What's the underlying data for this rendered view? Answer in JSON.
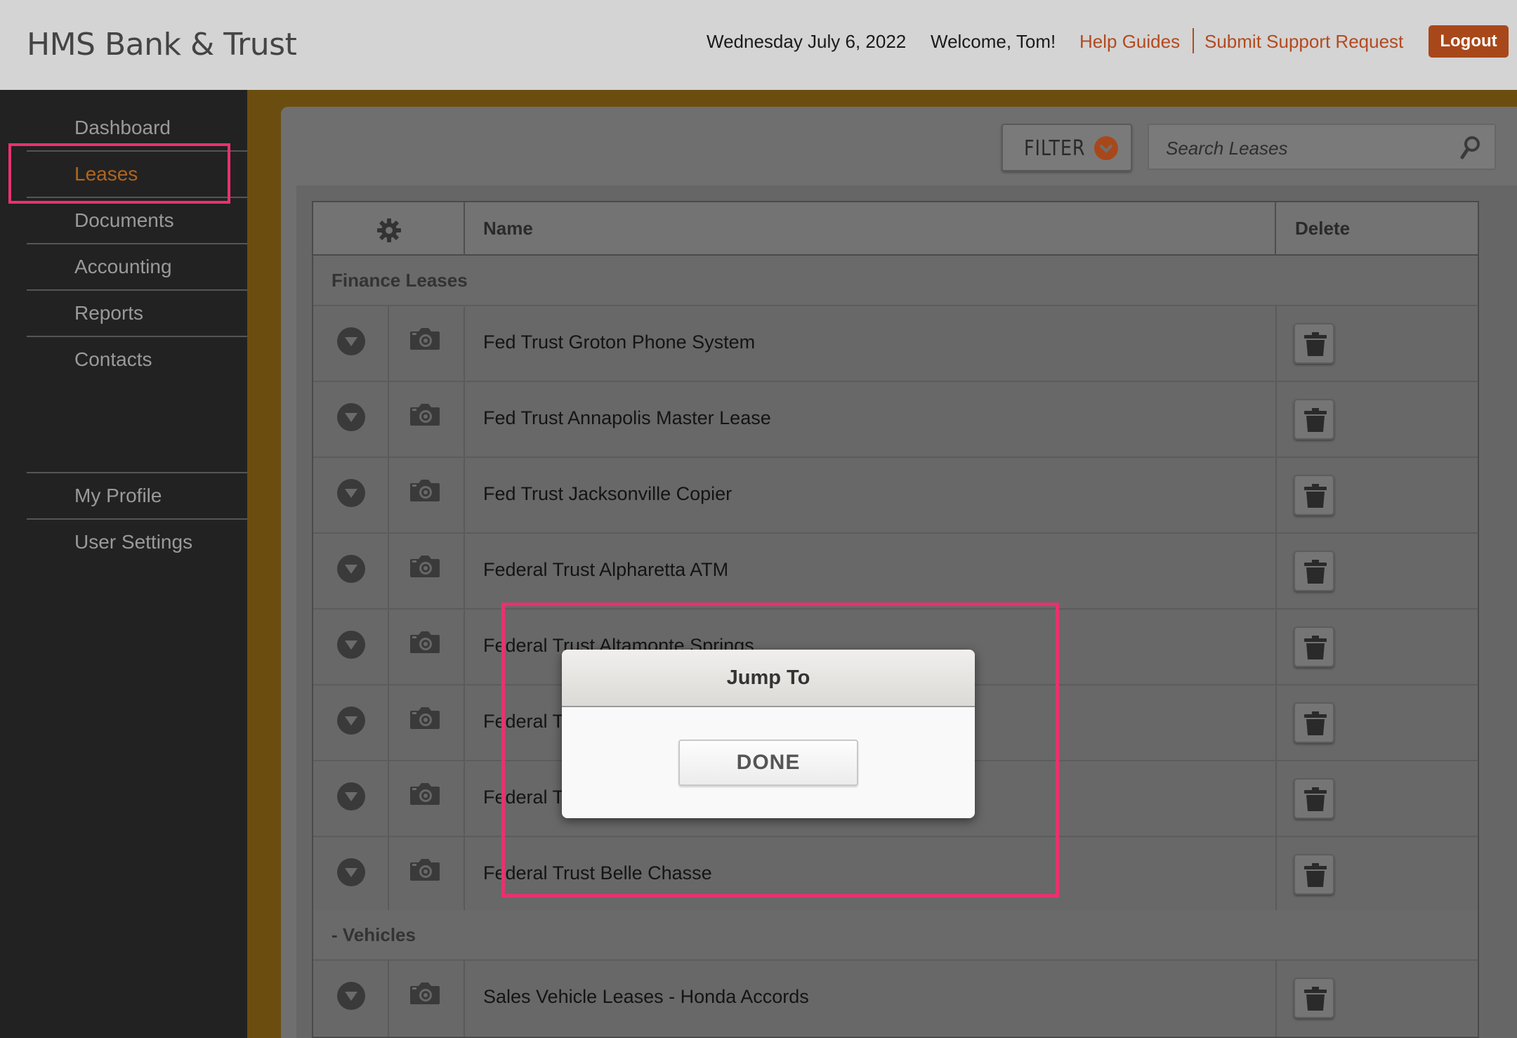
{
  "header": {
    "brand": "HMS Bank & Trust",
    "date": "Wednesday July 6, 2022",
    "welcome": "Welcome, Tom!",
    "help_link": "Help Guides",
    "support_link": "Submit Support Request",
    "logout_label": "Logout"
  },
  "sidebar": {
    "items": [
      {
        "label": "Dashboard"
      },
      {
        "label": "Leases"
      },
      {
        "label": "Documents"
      },
      {
        "label": "Accounting"
      },
      {
        "label": "Reports"
      },
      {
        "label": "Contacts"
      }
    ],
    "secondary": [
      {
        "label": "My Profile"
      },
      {
        "label": "User Settings"
      }
    ],
    "active": "Leases"
  },
  "toolbar": {
    "filter_label": "FILTER",
    "search_placeholder": "Search Leases"
  },
  "table": {
    "columns": {
      "name": "Name",
      "delete": "Delete"
    },
    "sections": [
      {
        "title": "Finance Leases",
        "rows": [
          {
            "name": "Fed Trust Groton Phone System"
          },
          {
            "name": "Fed Trust Annapolis Master Lease"
          },
          {
            "name": "Fed Trust Jacksonville Copier"
          },
          {
            "name": "Federal Trust Alpharetta ATM"
          },
          {
            "name": "Federal Trust Altamonte Springs"
          },
          {
            "name": "Federal T"
          },
          {
            "name": "Federal T"
          },
          {
            "name": "Federal Trust Belle Chasse"
          }
        ]
      },
      {
        "title": "- Vehicles",
        "rows": [
          {
            "name": "Sales Vehicle Leases - Honda Accords"
          }
        ]
      }
    ]
  },
  "modal": {
    "title": "Jump To",
    "done_label": "DONE"
  },
  "colors": {
    "accent": "#b34a1f",
    "highlight": "#e8326e",
    "active_nav": "#b0651f"
  }
}
